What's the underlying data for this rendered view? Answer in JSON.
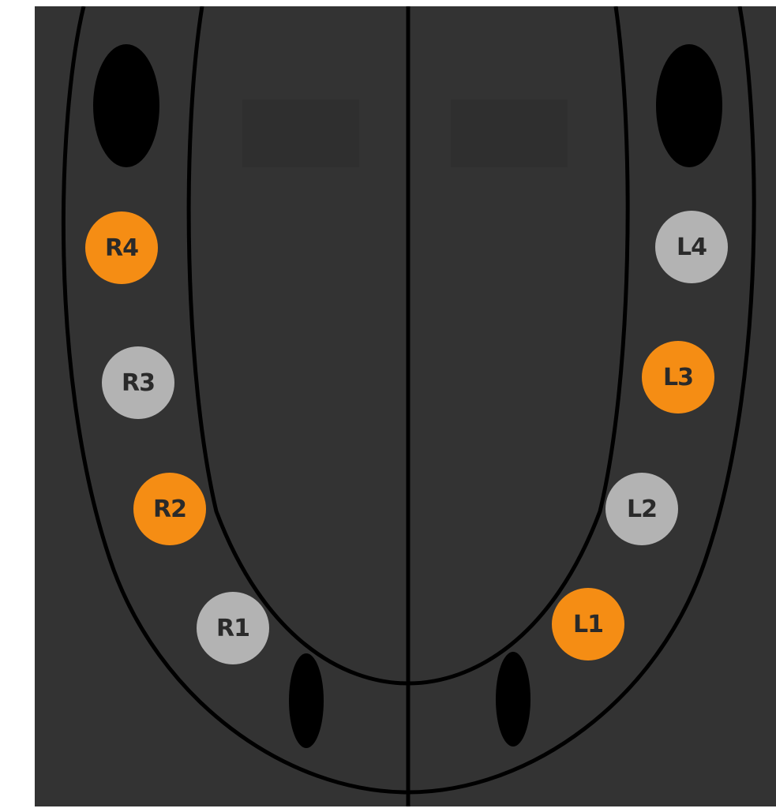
{
  "colors": {
    "panel_background": "#333333",
    "sensor_active": "#f58d14",
    "sensor_inactive": "#b3b3b3",
    "outline": "#000000"
  },
  "sensors": {
    "R4": {
      "label": "R4",
      "state": "active"
    },
    "R3": {
      "label": "R3",
      "state": "inactive"
    },
    "R2": {
      "label": "R2",
      "state": "active"
    },
    "R1": {
      "label": "R1",
      "state": "inactive"
    },
    "L4": {
      "label": "L4",
      "state": "inactive"
    },
    "L3": {
      "label": "L3",
      "state": "active"
    },
    "L2": {
      "label": "L2",
      "state": "inactive"
    },
    "L1": {
      "label": "L1",
      "state": "active"
    }
  }
}
